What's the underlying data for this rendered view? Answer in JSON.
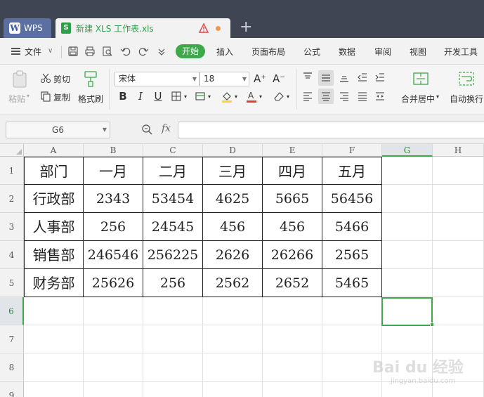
{
  "titlebar": {
    "wps_tab_label": "WPS",
    "wps_logo": "W",
    "file_tab_label": "新建 XLS 工作表.xls",
    "file_icon": "S",
    "new_tab_symbol": "+"
  },
  "menubar": {
    "file_label": "文件",
    "start_label": "开始",
    "tabs": [
      "插入",
      "页面布局",
      "公式",
      "数据",
      "审阅",
      "视图",
      "开发工具"
    ]
  },
  "ribbon": {
    "paste_label": "粘贴",
    "cut_label": "剪切",
    "copy_label": "复制",
    "format_painter_label": "格式刷",
    "font_name": "宋体",
    "font_size": "18",
    "grow_font": "A⁺",
    "shrink_font": "A⁻",
    "bold": "B",
    "italic": "I",
    "underline": "U",
    "merge_center_label": "合并居中",
    "wrap_text_label": "自动换行"
  },
  "formula_bar": {
    "name_box": "G6",
    "fx_label": "fx",
    "formula": ""
  },
  "sheet": {
    "columns": [
      "A",
      "B",
      "C",
      "D",
      "E",
      "F",
      "G",
      "H"
    ],
    "row_numbers": [
      "1",
      "2",
      "3",
      "4",
      "5",
      "6",
      "7",
      "8",
      "9"
    ],
    "selected_cell": "G6",
    "table": [
      [
        "部门",
        "一月",
        "二月",
        "三月",
        "四月",
        "五月"
      ],
      [
        "行政部",
        "2343",
        "53454",
        "4625",
        "5665",
        "56456"
      ],
      [
        "人事部",
        "256",
        "24545",
        "456",
        "456",
        "5466"
      ],
      [
        "销售部",
        "246546",
        "256225",
        "2626",
        "26266",
        "2565"
      ],
      [
        "财务部",
        "25626",
        "256",
        "2562",
        "2652",
        "5465"
      ]
    ]
  },
  "watermark": {
    "text": "Bai du 经验",
    "sub": "jingyan.baidu.com"
  },
  "colors": {
    "accent_green": "#3fa84a",
    "titlebar_bg": "#3f4553",
    "file_tab_text": "#2ea04a"
  }
}
